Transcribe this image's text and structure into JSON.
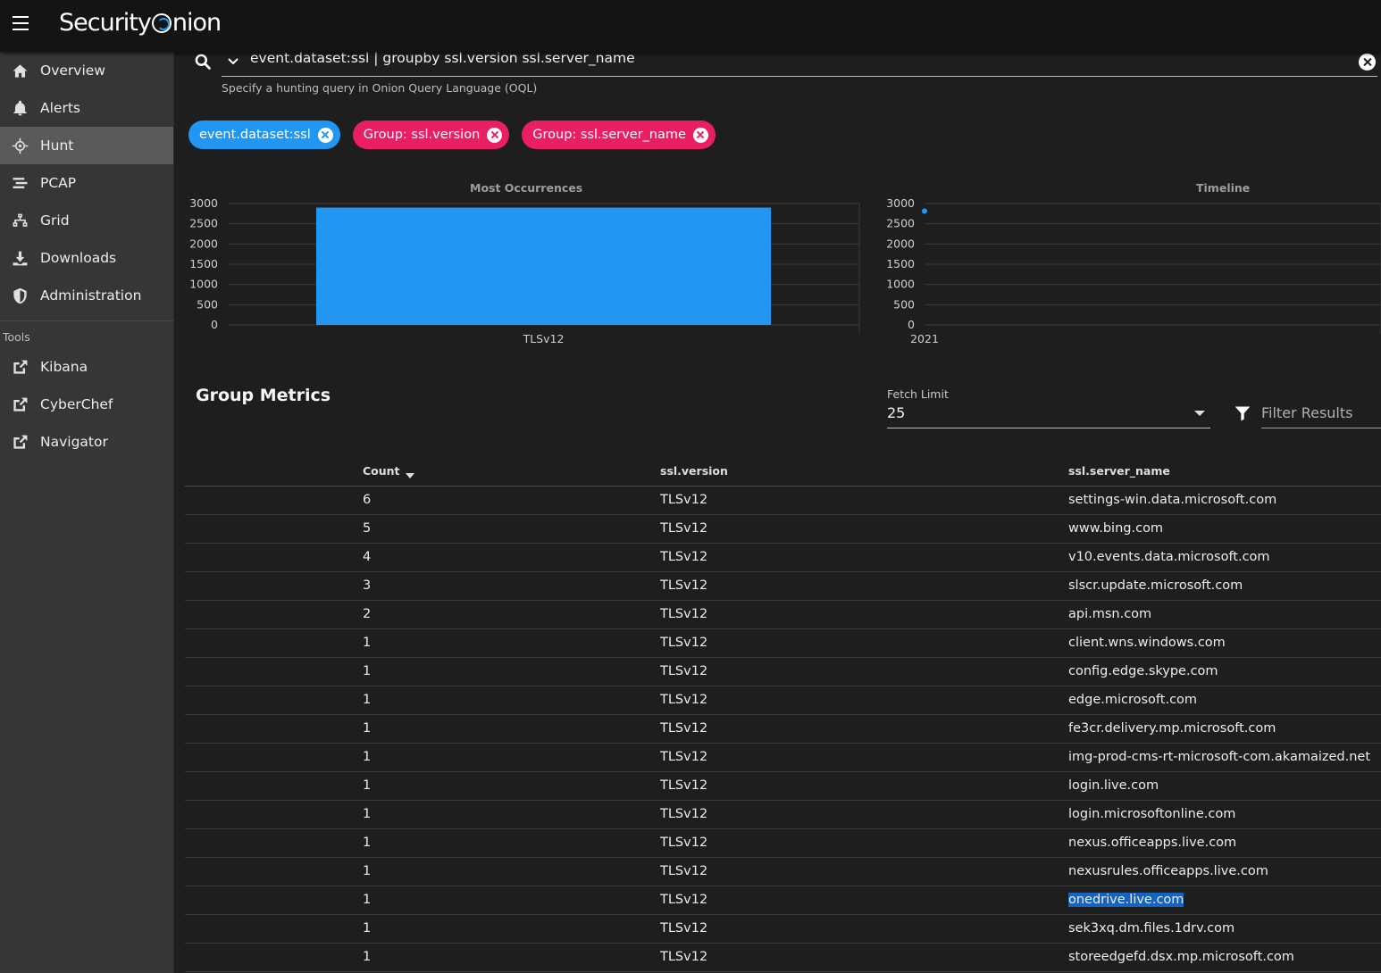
{
  "app": {
    "logo_text": "Security Onion"
  },
  "sidebar": {
    "items": [
      {
        "label": "Overview",
        "icon": "home-icon"
      },
      {
        "label": "Alerts",
        "icon": "bell-icon"
      },
      {
        "label": "Hunt",
        "icon": "crosshairs-icon",
        "active": true
      },
      {
        "label": "PCAP",
        "icon": "stream-icon"
      },
      {
        "label": "Grid",
        "icon": "sitemap-icon"
      },
      {
        "label": "Downloads",
        "icon": "download-icon"
      },
      {
        "label": "Administration",
        "icon": "shield-icon"
      }
    ],
    "tools_label": "Tools",
    "tools": [
      {
        "label": "Kibana",
        "icon": "external-link-icon"
      },
      {
        "label": "CyberChef",
        "icon": "external-link-icon"
      },
      {
        "label": "Navigator",
        "icon": "external-link-icon"
      }
    ]
  },
  "search": {
    "query": "event.dataset:ssl | groupby ssl.version ssl.server_name",
    "hint": "Specify a hunting query in Onion Query Language (OQL)"
  },
  "chips": [
    {
      "label": "event.dataset:ssl",
      "color": "#2196f3"
    },
    {
      "label": "Group: ssl.version",
      "color": "#e91e63"
    },
    {
      "label": "Group: ssl.server_name",
      "color": "#e91e63"
    }
  ],
  "chart_data": [
    {
      "type": "bar",
      "title": "Most Occurrences",
      "categories": [
        "TLSv12"
      ],
      "values": [
        2900
      ],
      "ylim": [
        0,
        3000
      ],
      "yticks": [
        0,
        500,
        1000,
        1500,
        2000,
        2500,
        3000
      ],
      "color": "#2196f3",
      "grid": true
    },
    {
      "type": "scatter",
      "title": "Timeline",
      "x": [
        "2021"
      ],
      "values": [
        2900
      ],
      "ylim": [
        0,
        3000
      ],
      "yticks": [
        0,
        500,
        1000,
        1500,
        2000,
        2500,
        3000
      ],
      "color": "#2196f3",
      "grid": true
    }
  ],
  "metrics": {
    "title": "Group Metrics",
    "fetch_limit_label": "Fetch Limit",
    "fetch_limit_value": "25",
    "filter_placeholder": "Filter Results",
    "columns": [
      "Count",
      "ssl.version",
      "ssl.server_name"
    ],
    "rows": [
      {
        "count": "6",
        "version": "TLSv12",
        "server": "settings-win.data.microsoft.com"
      },
      {
        "count": "5",
        "version": "TLSv12",
        "server": "www.bing.com"
      },
      {
        "count": "4",
        "version": "TLSv12",
        "server": "v10.events.data.microsoft.com"
      },
      {
        "count": "3",
        "version": "TLSv12",
        "server": "slscr.update.microsoft.com"
      },
      {
        "count": "2",
        "version": "TLSv12",
        "server": "api.msn.com"
      },
      {
        "count": "1",
        "version": "TLSv12",
        "server": "client.wns.windows.com"
      },
      {
        "count": "1",
        "version": "TLSv12",
        "server": "config.edge.skype.com"
      },
      {
        "count": "1",
        "version": "TLSv12",
        "server": "edge.microsoft.com"
      },
      {
        "count": "1",
        "version": "TLSv12",
        "server": "fe3cr.delivery.mp.microsoft.com"
      },
      {
        "count": "1",
        "version": "TLSv12",
        "server": "img-prod-cms-rt-microsoft-com.akamaized.net"
      },
      {
        "count": "1",
        "version": "TLSv12",
        "server": "login.live.com"
      },
      {
        "count": "1",
        "version": "TLSv12",
        "server": "login.microsoftonline.com"
      },
      {
        "count": "1",
        "version": "TLSv12",
        "server": "nexus.officeapps.live.com"
      },
      {
        "count": "1",
        "version": "TLSv12",
        "server": "nexusrules.officeapps.live.com"
      },
      {
        "count": "1",
        "version": "TLSv12",
        "server": "onedrive.live.com",
        "selected": true
      },
      {
        "count": "1",
        "version": "TLSv12",
        "server": "sek3xq.dm.files.1drv.com"
      },
      {
        "count": "1",
        "version": "TLSv12",
        "server": "storeedgefd.dsx.mp.microsoft.com"
      }
    ]
  }
}
